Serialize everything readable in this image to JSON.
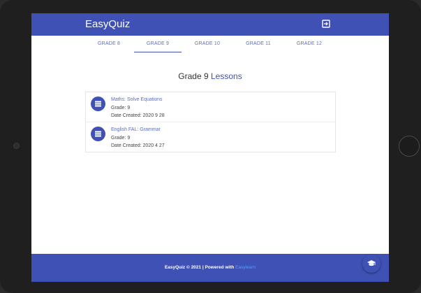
{
  "app": {
    "brand": "EasyQuiz"
  },
  "header": {
    "exit_icon": "exit-to-app-icon"
  },
  "tabs": [
    {
      "label": "GRADE 8",
      "active": false
    },
    {
      "label": "GRADE 9",
      "active": true
    },
    {
      "label": "GRADE 10",
      "active": false
    },
    {
      "label": "GRADE 11",
      "active": false
    },
    {
      "label": "GRADE 12",
      "active": false
    }
  ],
  "page": {
    "heading_prefix": "Grade 9",
    "heading_accent": "Lessons"
  },
  "lessons": [
    {
      "title": "Maths: Solve Equations",
      "grade_line": "Grade: 9",
      "date_line": "Date Created: 2020  9  28",
      "icon": "list-icon"
    },
    {
      "title": "English FAL: Grammar",
      "grade_line": "Grade: 9",
      "date_line": "Date Created: 2020  4  27",
      "icon": "list-icon"
    }
  ],
  "footer": {
    "text": "EasyQuiz © 2021 | Powered with",
    "link": "Easylearn"
  },
  "fab": {
    "icon": "graduation-cap-icon"
  },
  "colors": {
    "primary": "#3f51b5",
    "tab_text": "#5c6bc0",
    "link": "#4da3ff",
    "device_bezel": "#1f1f1f"
  }
}
